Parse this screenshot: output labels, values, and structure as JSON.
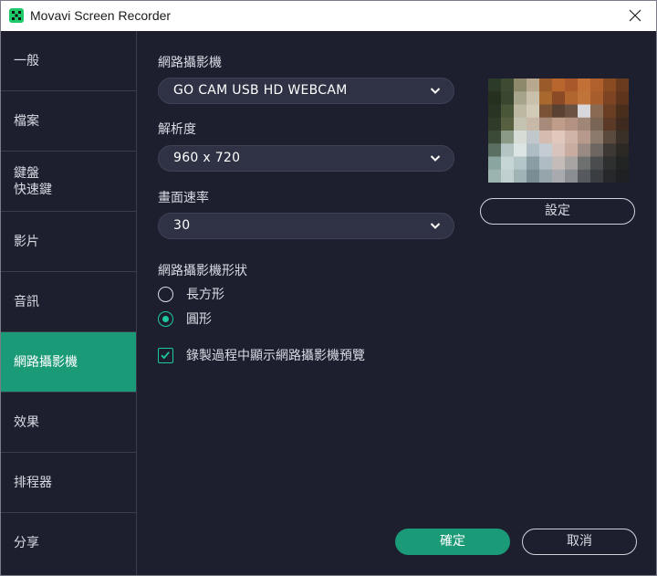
{
  "window": {
    "title": "Movavi Screen Recorder"
  },
  "sidebar": {
    "items": [
      {
        "label": "一般"
      },
      {
        "label": "檔案"
      },
      {
        "label": "鍵盤\n快速鍵"
      },
      {
        "label": "影片"
      },
      {
        "label": "音訊"
      },
      {
        "label": "網路攝影機",
        "active": true
      },
      {
        "label": "效果"
      },
      {
        "label": "排程器"
      },
      {
        "label": "分享"
      }
    ]
  },
  "webcam": {
    "device_label": "網路攝影機",
    "device_value": "GO CAM USB HD WEBCAM",
    "resolution_label": "解析度",
    "resolution_value": "960 x 720",
    "framerate_label": "畫面速率",
    "framerate_value": "30",
    "shape_label": "網路攝影機形狀",
    "shape_options": [
      {
        "label": "長方形",
        "selected": false
      },
      {
        "label": "圓形",
        "selected": true
      }
    ],
    "show_preview_label": "錄製過程中顯示網路攝影機預覽",
    "show_preview_checked": true,
    "settings_button": "設定"
  },
  "footer": {
    "ok_label": "確定",
    "cancel_label": "取消"
  },
  "colors": {
    "background": "#1d1f2e",
    "accent": "#1b9a78",
    "accent_bright": "#1ec9a0",
    "control_bg": "#2f3244"
  }
}
